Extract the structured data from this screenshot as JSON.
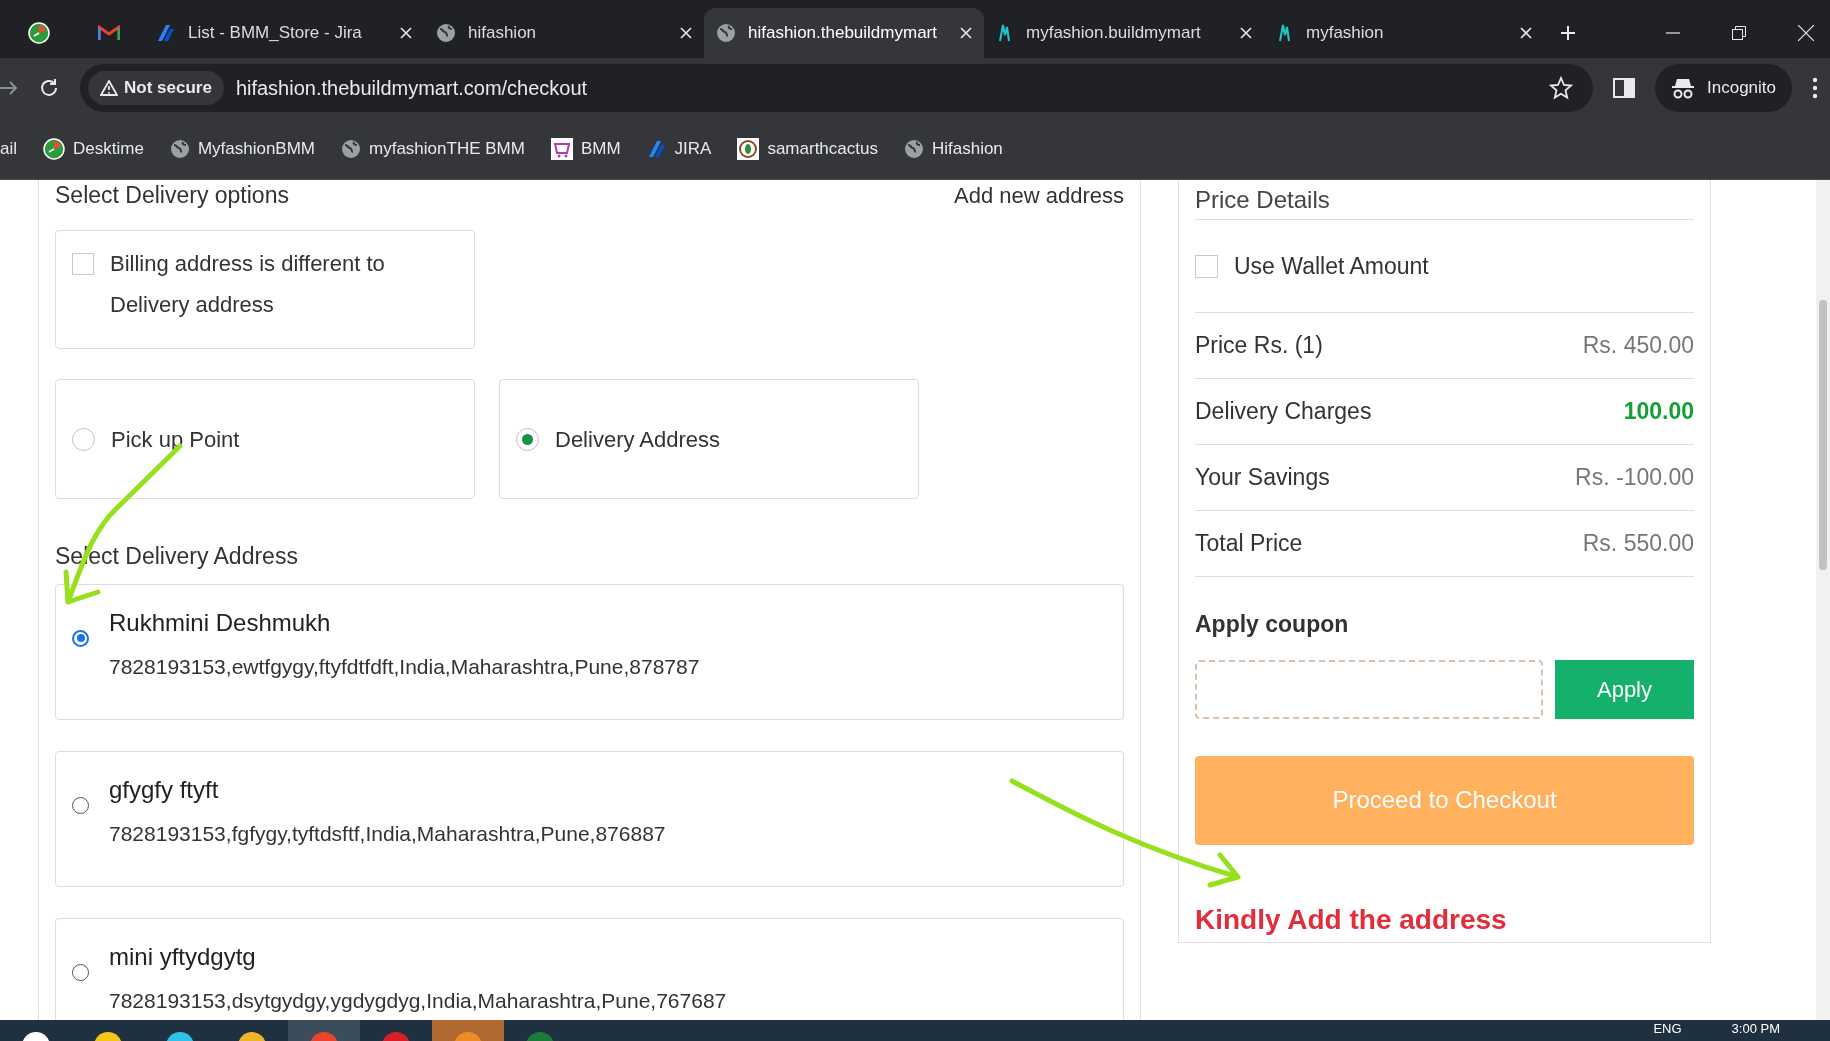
{
  "tabs": [
    {
      "kind": "desktime",
      "selected": false
    },
    {
      "kind": "gmail",
      "selected": false
    },
    {
      "kind": "jira",
      "title": "List - BMM_Store - Jira",
      "selected": false
    },
    {
      "kind": "globe",
      "title": "hifashion",
      "selected": false
    },
    {
      "kind": "globe",
      "title": "hifashion.thebuildmymart",
      "selected": true
    },
    {
      "kind": "myfashion",
      "title": "myfashion.buildmymart",
      "selected": false
    },
    {
      "kind": "myfashion",
      "title": "myfashion",
      "selected": false
    }
  ],
  "address_bar": {
    "security": "Not secure",
    "url": "hifashion.thebuildmymart.com/checkout",
    "profile": "Incognito"
  },
  "bookmarks": [
    {
      "kind": "plain",
      "label": "ail"
    },
    {
      "kind": "desktime",
      "label": "Desktime"
    },
    {
      "kind": "globe",
      "label": "MyfashionBMM"
    },
    {
      "kind": "globe",
      "label": "myfashionTHE BMM"
    },
    {
      "kind": "bmm",
      "label": "BMM"
    },
    {
      "kind": "jira",
      "label": "JIRA"
    },
    {
      "kind": "cactus",
      "label": "samarthcactus"
    },
    {
      "kind": "globe",
      "label": "Hifashion"
    }
  ],
  "delivery": {
    "title": "Select Delivery options",
    "add_link": "Add new address",
    "billing": {
      "label_line1": "Billing address is different to",
      "label_line2": "Delivery address",
      "checked": false
    },
    "options": [
      {
        "label": "Pick up Point",
        "selected": false
      },
      {
        "label": "Delivery Address",
        "selected": true
      }
    ],
    "address_title": "Select Delivery Address",
    "addresses": [
      {
        "name": "Rukhmini Deshmukh",
        "details": "7828193153,ewtfgygy,ftyfdtfdft,India,Maharashtra,Pune,878787",
        "selected": true
      },
      {
        "name": "gfygfy ftyft",
        "details": "7828193153,fgfygy,tyftdsftf,India,Maharashtra,Pune,876887",
        "selected": false
      },
      {
        "name": "mini yftydgytg",
        "details": "7828193153,dsytgydgy,ygdygdyg,India,Maharashtra,Pune,767687",
        "selected": false
      }
    ]
  },
  "price": {
    "title": "Price Details",
    "wallet": {
      "label": "Use Wallet Amount",
      "checked": false
    },
    "rows": [
      {
        "label": "Price Rs. (1)",
        "value": "Rs. 450.00",
        "kind": "normal"
      },
      {
        "label": "Delivery Charges",
        "value": "100.00",
        "kind": "positive"
      },
      {
        "label": "Your Savings",
        "value": "Rs. -100.00",
        "kind": "normal"
      },
      {
        "label": "Total Price",
        "value": "Rs. 550.00",
        "kind": "normal"
      }
    ],
    "coupon_title": "Apply coupon",
    "apply": "Apply",
    "checkout": "Proceed to Checkout",
    "error": "Kindly Add the address"
  },
  "taskbar": {
    "language": "ENG",
    "time": "3:00 PM"
  }
}
